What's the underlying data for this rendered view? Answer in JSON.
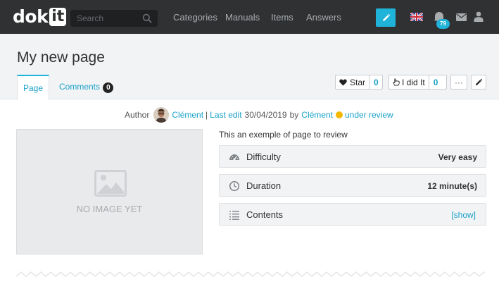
{
  "nav": {
    "logo_text": "dok",
    "logo_badge": "it",
    "search_placeholder": "Search",
    "links": [
      "Categories",
      "Manuals",
      "Items",
      "Answers"
    ],
    "notification_count": "79",
    "flag": "uk-flag",
    "accent_color": "#1fb3d9"
  },
  "page": {
    "title": "My new page",
    "tabs": [
      {
        "label": "Page",
        "active": true
      },
      {
        "label": "Comments",
        "badge": "0"
      }
    ],
    "actions": {
      "star_label": "Star",
      "star_count": "0",
      "didit_label": "I did It",
      "didit_count": "0",
      "more_label": "···"
    }
  },
  "meta": {
    "author_label": "Author",
    "author_name": "Clément",
    "separator": "|",
    "last_edit_label": "Last edit",
    "last_edit_date": "30/04/2019",
    "by_label": "by",
    "editor_name": "Clément",
    "status": "under review",
    "status_color": "#f5b800"
  },
  "media": {
    "placeholder_text": "NO IMAGE YET"
  },
  "details": {
    "description": "This an exemple of page to review",
    "rows": [
      {
        "label": "Difficulty",
        "value": "Very easy",
        "icon": "gauge-icon"
      },
      {
        "label": "Duration",
        "value": "12 minute(s)",
        "icon": "clock-icon"
      },
      {
        "label": "Contents",
        "value": "[show]",
        "icon": "list-icon"
      }
    ]
  }
}
